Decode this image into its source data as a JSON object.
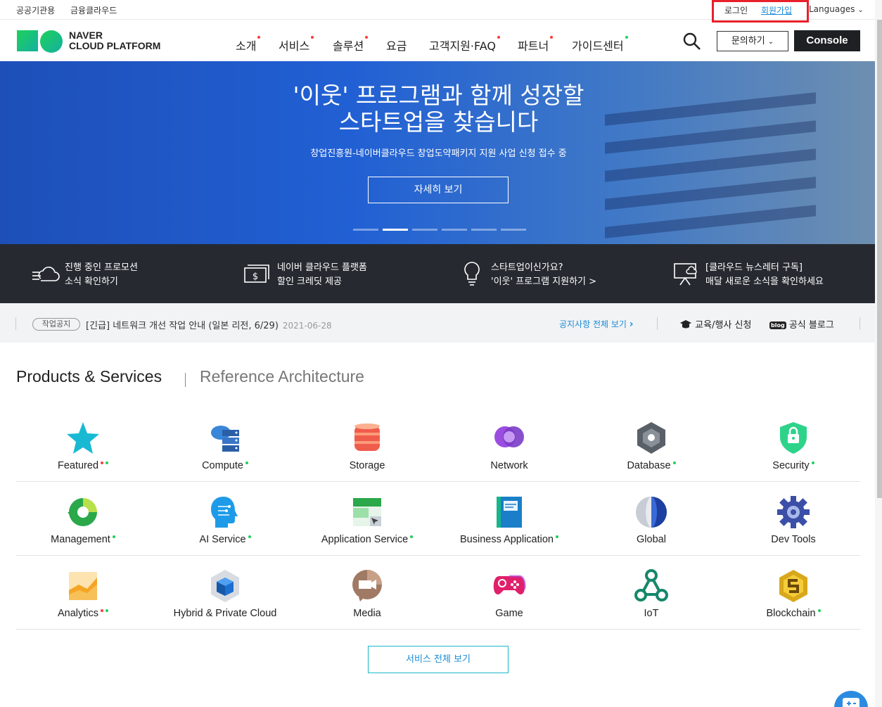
{
  "util": {
    "public": "공공기관용",
    "finance": "금융클라우드",
    "login": "로그인",
    "signup": "회원가입",
    "languages": "Languages"
  },
  "header": {
    "logo_line1": "NAVER",
    "logo_line2": "CLOUD PLATFORM",
    "nav": [
      "소개",
      "서비스",
      "솔루션",
      "요금",
      "고객지원·FAQ",
      "파트너",
      "가이드센터"
    ],
    "inquiry": "문의하기",
    "console": "Console"
  },
  "hero": {
    "title": "'이웃' 프로그램과 함께 성장할\n스타트업을 찾습니다",
    "subtitle": "창업진흥원-네이버클라우드 창업도약패키지 지원 사업 신청 접수 중",
    "button": "자세히 보기",
    "active_slide": 2,
    "slides": 6
  },
  "promo": [
    {
      "line1": "진행 중인 프로모션",
      "line2": "소식 확인하기",
      "icon": "cloud-list-icon"
    },
    {
      "line1": "네이버 클라우드 플랫폼",
      "line2": "할인 크레딧 제공",
      "icon": "dollar-bill-icon"
    },
    {
      "line1": "스타트업이신가요?",
      "line2": "'이웃' 프로그램 지원하기 >",
      "icon": "lightbulb-icon"
    },
    {
      "line1": "[클라우드 뉴스레터 구독]",
      "line2": "매달 새로운 소식을 확인하세요",
      "icon": "presentation-icon"
    }
  ],
  "notice": {
    "tag": "작업공지",
    "text": "[긴급] 네트워크 개선 작업 안내 (일본 리전, 6/29)",
    "date": "2021-06-28",
    "view_all": "공지사항 전체 보기",
    "edu": "교육/행사 신청",
    "blog": "공식 블로그",
    "blog_badge": "blog"
  },
  "products": {
    "tab_active": "Products & Services",
    "tab_other": "Reference Architecture",
    "items": [
      {
        "label": "Featured",
        "dots": [
          "red",
          "green"
        ]
      },
      {
        "label": "Compute",
        "dots": [
          "green"
        ]
      },
      {
        "label": "Storage",
        "dots": []
      },
      {
        "label": "Network",
        "dots": []
      },
      {
        "label": "Database",
        "dots": [
          "green"
        ]
      },
      {
        "label": "Security",
        "dots": [
          "green"
        ]
      },
      {
        "label": "Management",
        "dots": [
          "green"
        ]
      },
      {
        "label": "AI Service",
        "dots": [
          "green"
        ]
      },
      {
        "label": "Application Service",
        "dots": [
          "green"
        ]
      },
      {
        "label": "Business Application",
        "dots": [
          "green"
        ]
      },
      {
        "label": "Global",
        "dots": []
      },
      {
        "label": "Dev Tools",
        "dots": []
      },
      {
        "label": "Analytics",
        "dots": [
          "red",
          "green"
        ]
      },
      {
        "label": "Hybrid & Private Cloud",
        "dots": []
      },
      {
        "label": "Media",
        "dots": []
      },
      {
        "label": "Game",
        "dots": []
      },
      {
        "label": "IoT",
        "dots": []
      },
      {
        "label": "Blockchain",
        "dots": [
          "green"
        ]
      }
    ],
    "all_button": "서비스 전체 보기"
  },
  "colors": {
    "accent_red": "#ff3c3c",
    "accent_green": "#1fd15a",
    "link_blue": "#1a8bd6",
    "hero_blue": "#2160d4",
    "dark_bar": "#262a30"
  }
}
